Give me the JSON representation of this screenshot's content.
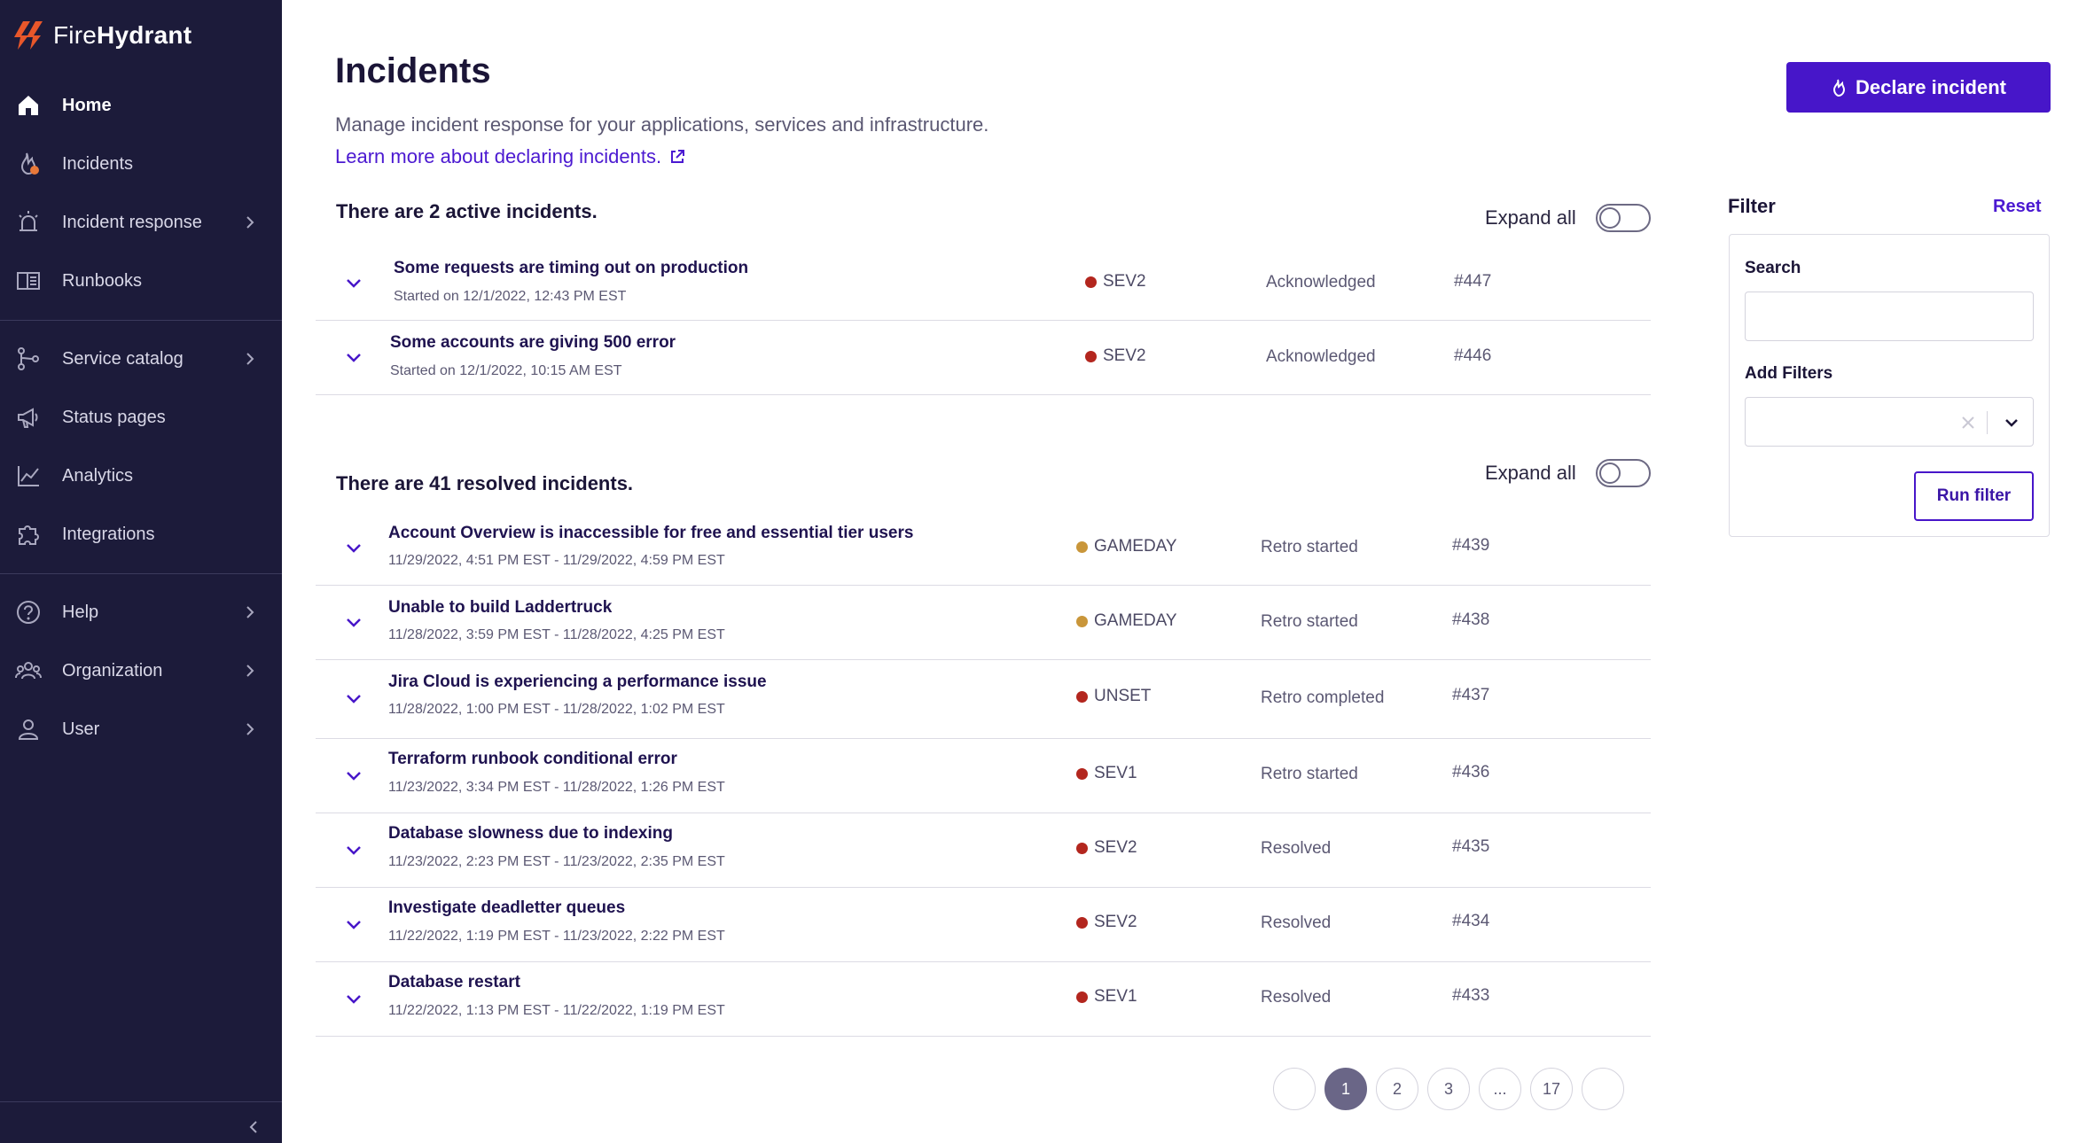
{
  "brand": {
    "name_light": "Fire",
    "name_bold": "Hydrant"
  },
  "sidebar": {
    "items": [
      {
        "label": "Home",
        "icon": "home-icon",
        "active": true
      },
      {
        "label": "Incidents",
        "icon": "fire-icon"
      },
      {
        "label": "Incident response",
        "icon": "siren-icon",
        "chevron": true
      },
      {
        "label": "Runbooks",
        "icon": "book-icon"
      },
      {
        "label": "Service catalog",
        "icon": "service-icon",
        "chevron": true
      },
      {
        "label": "Status pages",
        "icon": "megaphone-icon"
      },
      {
        "label": "Analytics",
        "icon": "chart-line-icon"
      },
      {
        "label": "Integrations",
        "icon": "puzzle-icon"
      },
      {
        "label": "Help",
        "icon": "help-circle-icon",
        "chevron": true
      },
      {
        "label": "Organization",
        "icon": "team-icon",
        "chevron": true
      },
      {
        "label": "User",
        "icon": "user-icon",
        "chevron": true
      }
    ]
  },
  "header": {
    "title": "Incidents",
    "subtitle": "Manage incident response for your applications, services and infrastructure.",
    "learn_link": "Learn more about declaring incidents.",
    "declare_button": "Declare incident"
  },
  "active_section": {
    "title": "There are 2 active incidents.",
    "expand_label": "Expand all",
    "rows": [
      {
        "title": "Some requests are timing out on production",
        "time": "Started on 12/1/2022, 12:43 PM EST",
        "severity": "SEV2",
        "sev_color": "#b3261e",
        "status": "Acknowledged",
        "number": "#447"
      },
      {
        "title": "Some accounts are giving 500 error",
        "time": "Started on 12/1/2022, 10:15 AM EST",
        "severity": "SEV2",
        "sev_color": "#b3261e",
        "status": "Acknowledged",
        "number": "#446"
      }
    ]
  },
  "resolved_section": {
    "title": "There are 41 resolved incidents.",
    "expand_label": "Expand all",
    "rows": [
      {
        "title": "Account Overview is inaccessible for free and essential tier users",
        "time": "11/29/2022, 4:51 PM EST - 11/29/2022, 4:59 PM EST",
        "severity": "GAMEDAY",
        "sev_color": "#c9963a",
        "status": "Retro started",
        "number": "#439"
      },
      {
        "title": "Unable to build Laddertruck",
        "time": "11/28/2022, 3:59 PM EST - 11/28/2022, 4:25 PM EST",
        "severity": "GAMEDAY",
        "sev_color": "#c9963a",
        "status": "Retro started",
        "number": "#438"
      },
      {
        "title": "Jira Cloud is experiencing a performance issue",
        "time": "11/28/2022, 1:00 PM EST - 11/28/2022, 1:02 PM EST",
        "severity": "UNSET",
        "sev_color": "#b3261e",
        "status": "Retro completed",
        "number": "#437"
      },
      {
        "title": "Terraform runbook conditional error",
        "time": "11/23/2022, 3:34 PM EST - 11/28/2022, 1:26 PM EST",
        "severity": "SEV1",
        "sev_color": "#b3261e",
        "status": "Retro started",
        "number": "#436"
      },
      {
        "title": "Database slowness due to indexing",
        "time": "11/23/2022, 2:23 PM EST - 11/23/2022, 2:35 PM EST",
        "severity": "SEV2",
        "sev_color": "#b3261e",
        "status": "Resolved",
        "number": "#435"
      },
      {
        "title": "Investigate deadletter queues",
        "time": "11/22/2022, 1:19 PM EST - 11/23/2022, 2:22 PM EST",
        "severity": "SEV2",
        "sev_color": "#b3261e",
        "status": "Resolved",
        "number": "#434"
      },
      {
        "title": "Database restart",
        "time": "11/22/2022, 1:13 PM EST - 11/22/2022, 1:19 PM EST",
        "severity": "SEV1",
        "sev_color": "#b3261e",
        "status": "Resolved",
        "number": "#433"
      }
    ]
  },
  "pagination": {
    "pages": [
      "",
      "1",
      "2",
      "3",
      "...",
      "17",
      ""
    ],
    "current": "1"
  },
  "filter": {
    "title": "Filter",
    "reset": "Reset",
    "search_label": "Search",
    "search_value": "",
    "add_filters_label": "Add Filters",
    "run_button": "Run filter"
  },
  "colors": {
    "sidebar_bg": "#1c1b3a",
    "accent": "#4716c9",
    "logo_orange": "#e8572a"
  }
}
